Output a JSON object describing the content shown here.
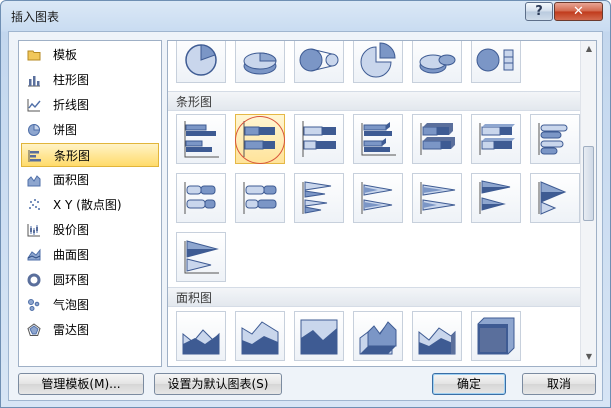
{
  "window": {
    "title": "插入图表",
    "help_label": "?",
    "close_label": "✕"
  },
  "categories": [
    {
      "label": "模板",
      "icon": "folder-icon"
    },
    {
      "label": "柱形图",
      "icon": "column-chart-icon"
    },
    {
      "label": "折线图",
      "icon": "line-chart-icon"
    },
    {
      "label": "饼图",
      "icon": "pie-chart-icon"
    },
    {
      "label": "条形图",
      "icon": "bar-chart-icon",
      "selected": true
    },
    {
      "label": "面积图",
      "icon": "area-chart-icon"
    },
    {
      "label": "X Y (散点图)",
      "icon": "scatter-chart-icon"
    },
    {
      "label": "股价图",
      "icon": "stock-chart-icon"
    },
    {
      "label": "曲面图",
      "icon": "surface-chart-icon"
    },
    {
      "label": "圆环图",
      "icon": "doughnut-chart-icon"
    },
    {
      "label": "气泡图",
      "icon": "bubble-chart-icon"
    },
    {
      "label": "雷达图",
      "icon": "radar-chart-icon"
    }
  ],
  "gallery": {
    "sections": [
      {
        "label": "条形图"
      },
      {
        "label": "面积图"
      }
    ],
    "pie_thumbs": [
      "pie-chart-icon",
      "pie-3d-chart-icon",
      "pie-of-pie-chart-icon",
      "exploded-pie-chart-icon",
      "exploded-pie-3d-chart-icon",
      "bar-of-pie-chart-icon"
    ],
    "bar_thumbs": [
      "clustered-bar-icon",
      "stacked-bar-icon",
      "100-stacked-bar-icon",
      "clustered-bar-3d-icon",
      "stacked-bar-3d-icon",
      "100-stacked-bar-3d-icon",
      "clustered-cylinder-bar-icon",
      "stacked-cylinder-bar-icon",
      "100-stacked-cylinder-bar-icon",
      "clustered-cone-bar-icon",
      "stacked-cone-bar-icon",
      "100-stacked-cone-bar-icon",
      "clustered-pyramid-bar-icon",
      "stacked-pyramid-bar-icon",
      "100-stacked-pyramid-bar-icon"
    ],
    "area_thumbs": [
      "area-icon",
      "stacked-area-icon",
      "100-stacked-area-icon",
      "area-3d-icon",
      "stacked-area-3d-icon",
      "100-stacked-area-3d-icon"
    ],
    "selected_thumb": "stacked-bar-icon"
  },
  "buttons": {
    "manage_templates": "管理模板(M)...",
    "set_default": "设置为默认图表(S)",
    "ok": "确定",
    "cancel": "取消"
  },
  "colors": {
    "accent_blue": "#4f6fa8",
    "selection_yellow": "#ffdb6b",
    "highlight_circle": "#d8553b"
  }
}
